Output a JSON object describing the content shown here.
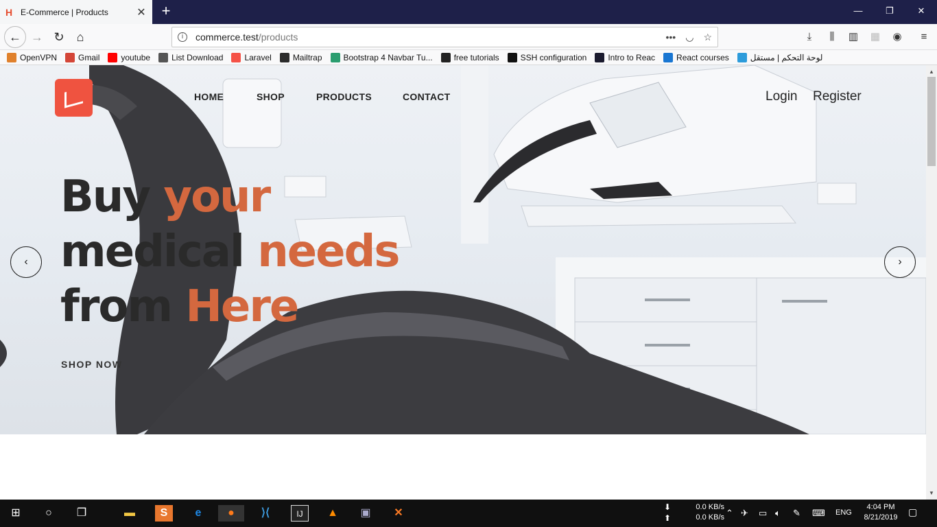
{
  "browser": {
    "tab_title": "E-Commerce | Products",
    "tab_favicon": "H",
    "url_host": "commerce.test",
    "url_path": "/products",
    "url_more": "•••",
    "bookmarks": [
      {
        "label": "OpenVPN",
        "color": "#e0812c"
      },
      {
        "label": "Gmail",
        "color": "#d44638"
      },
      {
        "label": "youtube",
        "color": "#ff0000"
      },
      {
        "label": "List Download",
        "color": "#555555"
      },
      {
        "label": "Laravel",
        "color": "#f55247"
      },
      {
        "label": "Mailtrap",
        "color": "#2b2b2b"
      },
      {
        "label": "Bootstrap 4 Navbar Tu...",
        "color": "#2a9d6f"
      },
      {
        "label": "free tutorials",
        "color": "#222222"
      },
      {
        "label": "SSH configuration",
        "color": "#111111"
      },
      {
        "label": "Intro to Reac",
        "color": "#1a1a2e"
      },
      {
        "label": "React courses",
        "color": "#1976d2"
      },
      {
        "label": "لوحة التحكم | مستقل",
        "color": "#2d9cdb"
      }
    ]
  },
  "site": {
    "nav": {
      "home": "HOME",
      "shop": "SHOP",
      "products": "PRODUCTS",
      "contact": "CONTACT"
    },
    "auth": {
      "login": "Login",
      "register": "Register"
    },
    "hero": {
      "line1_a": "Buy ",
      "line1_b": "your",
      "line2_a": "medical ",
      "line2_b": "needs",
      "line3_a": "from ",
      "line3_b": "Here",
      "cta": "SHOP NOW",
      "prev": "‹",
      "next": "›"
    },
    "accent_color": "#d4683f"
  },
  "taskbar": {
    "net_down": "0.0 KB/s",
    "net_up": "0.0 KB/s",
    "lang": "ENG",
    "time": "4:04 PM",
    "date": "8/21/2019"
  }
}
